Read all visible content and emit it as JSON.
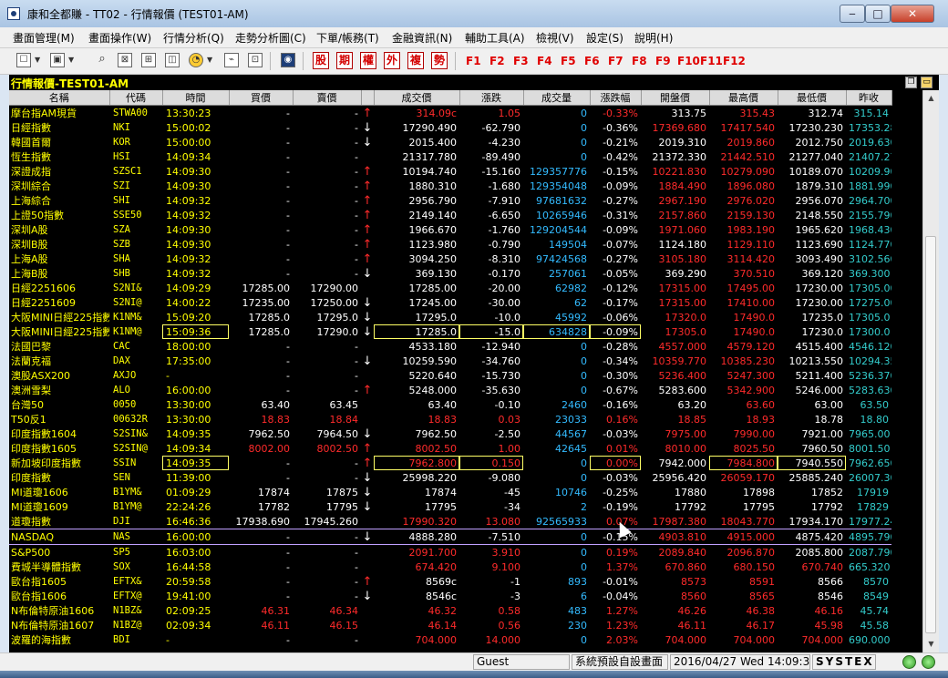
{
  "window": {
    "title": "康和全都賺 - TT02 - 行情報價 (TEST01-AM)",
    "min_glyph": "‒",
    "max_glyph": "□",
    "close_glyph": "✕"
  },
  "menu": [
    "畫面管理(M)",
    "畫面操作(W)",
    "行情分析(Q)",
    "走勢分析圖(C)",
    "下單/帳務(T)",
    "金融資訊(N)",
    "輔助工具(A)",
    "檢視(V)",
    "設定(S)",
    "說明(H)"
  ],
  "toolbar": {
    "order_buttons": [
      "股",
      "期",
      "權",
      "外",
      "複",
      "勢"
    ],
    "function_keys": [
      "F1",
      "F2",
      "F3",
      "F4",
      "F5",
      "F6",
      "F7",
      "F8",
      "F9",
      "F10",
      "F11",
      "F12"
    ]
  },
  "panel": {
    "title": "行情報價-TEST01-AM"
  },
  "columns": [
    "名稱",
    "代碼",
    "時間",
    "買價",
    "賣價",
    "",
    "成交價",
    "漲跌",
    "成交量",
    "漲跌幅",
    "開盤價",
    "最高價",
    "最低價",
    "昨收"
  ],
  "rows": [
    {
      "name": "摩台指AM現貨",
      "code": "STWA00",
      "time": "13:30:23",
      "bid": "-",
      "ask": "-",
      "arrow": "↑",
      "price": "314.09c",
      "chg": "1.05",
      "vol": "0",
      "pct": "-0.33%",
      "open": "313.75",
      "high": "315.43",
      "low": "312.74",
      "prev": "315.14"
    },
    {
      "name": "日經指數",
      "code": "NKI",
      "time": "15:00:02",
      "bid": "-",
      "ask": "-",
      "arrow": "↓",
      "price": "17290.490",
      "chg": "-62.790",
      "vol": "0",
      "pct": "-0.36%",
      "open": "17369.680",
      "high": "17417.540",
      "low": "17230.230",
      "prev": "17353.280"
    },
    {
      "name": "韓國首爾",
      "code": "KOR",
      "time": "15:00:00",
      "bid": "-",
      "ask": "-",
      "arrow": "↓",
      "price": "2015.400",
      "chg": "-4.230",
      "vol": "0",
      "pct": "-0.21%",
      "open": "2019.310",
      "high": "2019.860",
      "low": "2012.750",
      "prev": "2019.630"
    },
    {
      "name": "恆生指數",
      "code": "HSI",
      "time": "14:09:34",
      "bid": "-",
      "ask": "-",
      "arrow": "",
      "price": "21317.780",
      "chg": "-89.490",
      "vol": "0",
      "pct": "-0.42%",
      "open": "21372.330",
      "high": "21442.510",
      "low": "21277.040",
      "prev": "21407.270"
    },
    {
      "name": "深證成指",
      "code": "SZSC1",
      "time": "14:09:30",
      "bid": "-",
      "ask": "-",
      "arrow": "↑",
      "price": "10194.740",
      "chg": "-15.160",
      "vol": "129357776",
      "pct": "-0.15%",
      "open": "10221.830",
      "high": "10279.090",
      "low": "10189.070",
      "prev": "10209.900"
    },
    {
      "name": "深圳綜合",
      "code": "SZI",
      "time": "14:09:30",
      "bid": "-",
      "ask": "-",
      "arrow": "↑",
      "price": "1880.310",
      "chg": "-1.680",
      "vol": "129354048",
      "pct": "-0.09%",
      "open": "1884.490",
      "high": "1896.080",
      "low": "1879.310",
      "prev": "1881.990"
    },
    {
      "name": "上海綜合",
      "code": "SHI",
      "time": "14:09:32",
      "bid": "-",
      "ask": "-",
      "arrow": "↑",
      "price": "2956.790",
      "chg": "-7.910",
      "vol": "97681632",
      "pct": "-0.27%",
      "open": "2967.190",
      "high": "2976.020",
      "low": "2956.070",
      "prev": "2964.700"
    },
    {
      "name": "上證50指數",
      "code": "SSE50",
      "time": "14:09:32",
      "bid": "-",
      "ask": "-",
      "arrow": "↑",
      "price": "2149.140",
      "chg": "-6.650",
      "vol": "10265946",
      "pct": "-0.31%",
      "open": "2157.860",
      "high": "2159.130",
      "low": "2148.550",
      "prev": "2155.790"
    },
    {
      "name": "深圳A股",
      "code": "SZA",
      "time": "14:09:30",
      "bid": "-",
      "ask": "-",
      "arrow": "↑",
      "price": "1966.670",
      "chg": "-1.760",
      "vol": "129204544",
      "pct": "-0.09%",
      "open": "1971.060",
      "high": "1983.190",
      "low": "1965.620",
      "prev": "1968.430"
    },
    {
      "name": "深圳B股",
      "code": "SZB",
      "time": "14:09:30",
      "bid": "-",
      "ask": "-",
      "arrow": "↑",
      "price": "1123.980",
      "chg": "-0.790",
      "vol": "149504",
      "pct": "-0.07%",
      "open": "1124.180",
      "high": "1129.110",
      "low": "1123.690",
      "prev": "1124.770"
    },
    {
      "name": "上海A股",
      "code": "SHA",
      "time": "14:09:32",
      "bid": "-",
      "ask": "-",
      "arrow": "↑",
      "price": "3094.250",
      "chg": "-8.310",
      "vol": "97424568",
      "pct": "-0.27%",
      "open": "3105.180",
      "high": "3114.420",
      "low": "3093.490",
      "prev": "3102.560"
    },
    {
      "name": "上海B股",
      "code": "SHB",
      "time": "14:09:32",
      "bid": "-",
      "ask": "-",
      "arrow": "↓",
      "price": "369.130",
      "chg": "-0.170",
      "vol": "257061",
      "pct": "-0.05%",
      "open": "369.290",
      "high": "370.510",
      "low": "369.120",
      "prev": "369.300"
    },
    {
      "name": "日經2251606",
      "code": "S2NI&",
      "time": "14:09:29",
      "bid": "17285.00",
      "ask": "17290.00",
      "arrow": "",
      "price": "17285.00",
      "chg": "-20.00",
      "vol": "62982",
      "pct": "-0.12%",
      "open": "17315.00",
      "high": "17495.00",
      "low": "17230.00",
      "prev": "17305.00"
    },
    {
      "name": "日經2251609",
      "code": "S2NI@",
      "time": "14:00:22",
      "bid": "17235.00",
      "ask": "17250.00",
      "arrow": "↓",
      "price": "17245.00",
      "chg": "-30.00",
      "vol": "62",
      "pct": "-0.17%",
      "open": "17315.00",
      "high": "17410.00",
      "low": "17230.00",
      "prev": "17275.00"
    },
    {
      "name": "大阪MINI日經225指數",
      "code": "K1NM&",
      "time": "15:09:20",
      "bid": "17285.0",
      "ask": "17295.0",
      "arrow": "↓",
      "price": "17295.0",
      "chg": "-10.0",
      "vol": "45992",
      "pct": "-0.06%",
      "open": "17320.0",
      "high": "17490.0",
      "low": "17235.0",
      "prev": "17305.0"
    },
    {
      "name": "大阪MINI日經225指數",
      "code": "K1NM@",
      "time": "15:09:36",
      "bid": "17285.0",
      "ask": "17290.0",
      "arrow": "↓",
      "price": "17285.0",
      "chg": "-15.0",
      "vol": "634828",
      "pct": "-0.09%",
      "open": "17305.0",
      "high": "17490.0",
      "low": "17230.0",
      "prev": "17300.0"
    },
    {
      "name": "法國巴黎",
      "code": "CAC",
      "time": "18:00:00",
      "bid": "-",
      "ask": "-",
      "arrow": "",
      "price": "4533.180",
      "chg": "-12.940",
      "vol": "0",
      "pct": "-0.28%",
      "open": "4557.000",
      "high": "4579.120",
      "low": "4515.400",
      "prev": "4546.120"
    },
    {
      "name": "法蘭克福",
      "code": "DAX",
      "time": "17:35:00",
      "bid": "-",
      "ask": "-",
      "arrow": "↓",
      "price": "10259.590",
      "chg": "-34.760",
      "vol": "0",
      "pct": "-0.34%",
      "open": "10359.770",
      "high": "10385.230",
      "low": "10213.550",
      "prev": "10294.350"
    },
    {
      "name": "澳股ASX200",
      "code": "AXJO",
      "time": "-",
      "bid": "-",
      "ask": "-",
      "arrow": "",
      "price": "5220.640",
      "chg": "-15.730",
      "vol": "0",
      "pct": "-0.30%",
      "open": "5236.400",
      "high": "5247.300",
      "low": "5211.400",
      "prev": "5236.370"
    },
    {
      "name": "澳洲雪梨",
      "code": "ALO",
      "time": "16:00:00",
      "bid": "-",
      "ask": "-",
      "arrow": "↑",
      "price": "5248.000",
      "chg": "-35.630",
      "vol": "0",
      "pct": "-0.67%",
      "open": "5283.600",
      "high": "5342.900",
      "low": "5246.000",
      "prev": "5283.630"
    },
    {
      "name": "台灣50",
      "code": "0050",
      "time": "13:30:00",
      "bid": "63.40",
      "ask": "63.45",
      "arrow": "",
      "price": "63.40",
      "chg": "-0.10",
      "vol": "2460",
      "pct": "-0.16%",
      "open": "63.20",
      "high": "63.60",
      "low": "63.00",
      "prev": "63.50"
    },
    {
      "name": "T50反1",
      "code": "00632R",
      "time": "13:30:00",
      "bid": "18.83",
      "ask": "18.84",
      "arrow": "",
      "price": "18.83",
      "chg": "0.03",
      "vol": "23033",
      "pct": "0.16%",
      "open": "18.85",
      "high": "18.93",
      "low": "18.78",
      "prev": "18.80"
    },
    {
      "name": "印度指數1604",
      "code": "S2SIN&",
      "time": "14:09:35",
      "bid": "7962.50",
      "ask": "7964.50",
      "arrow": "↓",
      "price": "7962.50",
      "chg": "-2.50",
      "vol": "44567",
      "pct": "-0.03%",
      "open": "7975.00",
      "high": "7990.00",
      "low": "7921.00",
      "prev": "7965.00"
    },
    {
      "name": "印度指數1605",
      "code": "S2SIN@",
      "time": "14:09:34",
      "bid": "8002.00",
      "ask": "8002.50",
      "arrow": "↑",
      "price": "8002.50",
      "chg": "1.00",
      "vol": "42645",
      "pct": "0.01%",
      "open": "8010.00",
      "high": "8025.50",
      "low": "7960.50",
      "prev": "8001.50"
    },
    {
      "name": "新加坡印度指數",
      "code": "SSIN",
      "time": "14:09:35",
      "bid": "-",
      "ask": "-",
      "arrow": "↑",
      "price": "7962.800",
      "chg": "0.150",
      "vol": "0",
      "pct": "0.00%",
      "open": "7942.000",
      "high": "7984.800",
      "low": "7940.550",
      "prev": "7962.650"
    },
    {
      "name": "印度指數",
      "code": "SEN",
      "time": "11:39:00",
      "bid": "-",
      "ask": "-",
      "arrow": "↓",
      "price": "25998.220",
      "chg": "-9.080",
      "vol": "0",
      "pct": "-0.03%",
      "open": "25956.420",
      "high": "26059.170",
      "low": "25885.240",
      "prev": "26007.300"
    },
    {
      "name": "MI道瓊1606",
      "code": "B1YM&",
      "time": "01:09:29",
      "bid": "17874",
      "ask": "17875",
      "arrow": "↓",
      "price": "17874",
      "chg": "-45",
      "vol": "10746",
      "pct": "-0.25%",
      "open": "17880",
      "high": "17898",
      "low": "17852",
      "prev": "17919"
    },
    {
      "name": "MI道瓊1609",
      "code": "B1YM@",
      "time": "22:24:26",
      "bid": "17782",
      "ask": "17795",
      "arrow": "↓",
      "price": "17795",
      "chg": "-34",
      "vol": "2",
      "pct": "-0.19%",
      "open": "17792",
      "high": "17795",
      "low": "17792",
      "prev": "17829"
    },
    {
      "name": "道瓊指數",
      "code": "DJI",
      "time": "16:46:36",
      "bid": "17938.690",
      "ask": "17945.260",
      "arrow": "",
      "price": "17990.320",
      "chg": "13.080",
      "vol": "92565933",
      "pct": "0.07%",
      "open": "17987.380",
      "high": "18043.770",
      "low": "17934.170",
      "prev": "17977.240"
    },
    {
      "name": "NASDAQ",
      "code": "NAS",
      "time": "16:00:00",
      "bid": "-",
      "ask": "-",
      "arrow": "↓",
      "price": "4888.280",
      "chg": "-7.510",
      "vol": "0",
      "pct": "-0.15%",
      "open": "4903.810",
      "high": "4915.000",
      "low": "4875.420",
      "prev": "4895.790"
    },
    {
      "name": "S&P500",
      "code": "SP5",
      "time": "16:03:00",
      "bid": "-",
      "ask": "-",
      "arrow": "",
      "price": "2091.700",
      "chg": "3.910",
      "vol": "0",
      "pct": "0.19%",
      "open": "2089.840",
      "high": "2096.870",
      "low": "2085.800",
      "prev": "2087.790"
    },
    {
      "name": "費城半導體指數",
      "code": "SOX",
      "time": "16:44:58",
      "bid": "-",
      "ask": "-",
      "arrow": "",
      "price": "674.420",
      "chg": "9.100",
      "vol": "0",
      "pct": "1.37%",
      "open": "670.860",
      "high": "680.150",
      "low": "670.740",
      "prev": "665.320"
    },
    {
      "name": "歐台指1605",
      "code": "EFTX&",
      "time": "20:59:58",
      "bid": "-",
      "ask": "-",
      "arrow": "↑",
      "price": "8569c",
      "chg": "-1",
      "vol": "893",
      "pct": "-0.01%",
      "open": "8573",
      "high": "8591",
      "low": "8566",
      "prev": "8570"
    },
    {
      "name": "歐台指1606",
      "code": "EFTX@",
      "time": "19:41:00",
      "bid": "-",
      "ask": "-",
      "arrow": "↓",
      "price": "8546c",
      "chg": "-3",
      "vol": "6",
      "pct": "-0.04%",
      "open": "8560",
      "high": "8565",
      "low": "8546",
      "prev": "8549"
    },
    {
      "name": "N布倫特原油1606",
      "code": "N1BZ&",
      "time": "02:09:25",
      "bid": "46.31",
      "ask": "46.34",
      "arrow": "",
      "price": "46.32",
      "chg": "0.58",
      "vol": "483",
      "pct": "1.27%",
      "open": "46.26",
      "high": "46.38",
      "low": "46.16",
      "prev": "45.74"
    },
    {
      "name": "N布倫特原油1607",
      "code": "N1BZ@",
      "time": "02:09:34",
      "bid": "46.11",
      "ask": "46.15",
      "arrow": "",
      "price": "46.14",
      "chg": "0.56",
      "vol": "230",
      "pct": "1.23%",
      "open": "46.11",
      "high": "46.17",
      "low": "45.98",
      "prev": "45.58"
    },
    {
      "name": "波羅的海指數",
      "code": "BDI",
      "time": "-",
      "bid": "-",
      "ask": "-",
      "arrow": "",
      "price": "704.000",
      "chg": "14.000",
      "vol": "0",
      "pct": "2.03%",
      "open": "704.000",
      "high": "704.000",
      "low": "704.000",
      "prev": "690.000"
    }
  ],
  "status": {
    "user": "Guest",
    "layout": "系統預設自設畫面",
    "datetime": "2016/04/27 Wed 14:09:39",
    "brand": "SYSTEX"
  },
  "colors": {
    "up": "#ff2b2b",
    "name": "#ffff00",
    "volume": "#33bbff",
    "close": "#33cccc",
    "background": "#000000"
  }
}
